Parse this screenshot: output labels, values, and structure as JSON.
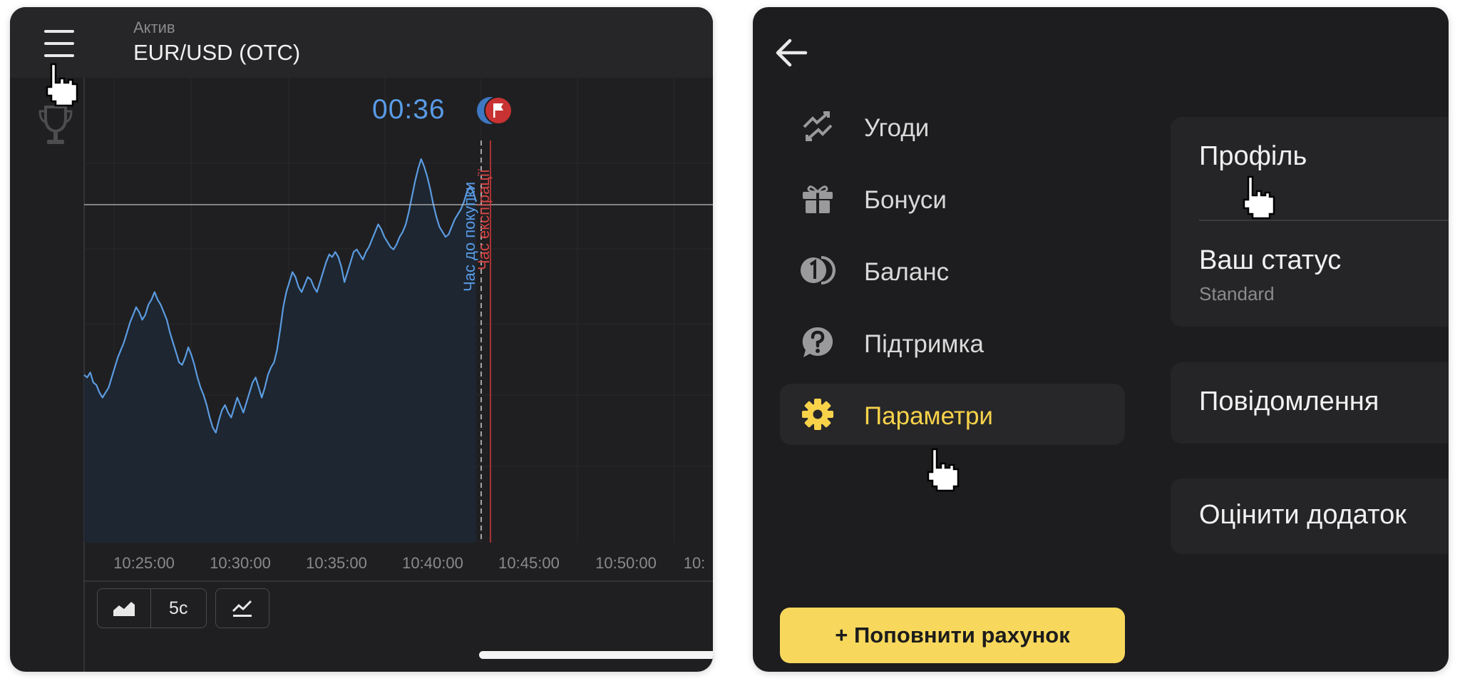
{
  "left_screen": {
    "asset_label": "Актив",
    "asset_name": "EUR/USD (OTC)",
    "countdown": "00:36",
    "purchase_time_label": "Час до покупки",
    "expiration_label": "Час експірації",
    "toolbar": {
      "chart_type_icon": "area-chart-icon",
      "period_label": "5с",
      "indicators_icon": "indicators-icon"
    },
    "colors": {
      "price_line": "#5b9be0",
      "expiration_line": "#d63a3a",
      "timer": "#5a9be6"
    }
  },
  "right_screen": {
    "menu": [
      {
        "label": "Угоди",
        "icon": "trades-icon"
      },
      {
        "label": "Бонуси",
        "icon": "gift-icon"
      },
      {
        "label": "Баланс",
        "icon": "balance-icon"
      },
      {
        "label": "Підтримка",
        "icon": "support-icon"
      },
      {
        "label": "Параметри",
        "icon": "settings-icon",
        "active": true
      }
    ],
    "deposit_button": "+ Поповнити рахунок",
    "settings": {
      "profile": "Профіль",
      "status_title": "Ваш статус",
      "status_value": "Standard",
      "notifications": "Повідомлення",
      "rate_app": "Оцінити додаток"
    },
    "colors": {
      "accent": "#f8d34a",
      "deposit_bg": "#f8d85c"
    }
  },
  "chart_data": {
    "type": "line",
    "x_tick_labels": [
      "10:25:00",
      "10:30:00",
      "10:35:00",
      "10:40:00",
      "10:45:00",
      "10:50:00",
      "10:"
    ],
    "series": [
      {
        "values": [
          0.45,
          0.44,
          0.46,
          0.42,
          0.41,
          0.38,
          0.36,
          0.38,
          0.4,
          0.44,
          0.48,
          0.52,
          0.55,
          0.58,
          0.62,
          0.66,
          0.69,
          0.72,
          0.7,
          0.67,
          0.69,
          0.73,
          0.75,
          0.78,
          0.75,
          0.73,
          0.7,
          0.67,
          0.62,
          0.58,
          0.54,
          0.5,
          0.49,
          0.52,
          0.56,
          0.53,
          0.49,
          0.44,
          0.4,
          0.37,
          0.33,
          0.28,
          0.24,
          0.22,
          0.27,
          0.31,
          0.33,
          0.3,
          0.28,
          0.32,
          0.36,
          0.33,
          0.3,
          0.34,
          0.38,
          0.42,
          0.44,
          0.4,
          0.36,
          0.4,
          0.45,
          0.48,
          0.5,
          0.55,
          0.63,
          0.72,
          0.78,
          0.82,
          0.86,
          0.84,
          0.8,
          0.78,
          0.81,
          0.84,
          0.83,
          0.8,
          0.78,
          0.82,
          0.86,
          0.9,
          0.93,
          0.92,
          0.94,
          0.92,
          0.88,
          0.82,
          0.86,
          0.9,
          0.94,
          0.95,
          0.93,
          0.91,
          0.94,
          0.96,
          0.99,
          1.02,
          1.05,
          1.03,
          1.0,
          0.98,
          0.96,
          0.95,
          0.97,
          1.0,
          1.02,
          1.05,
          1.1,
          1.16,
          1.22,
          1.27,
          1.31,
          1.28,
          1.24,
          1.19,
          1.13,
          1.08,
          1.04,
          1.02,
          1.0,
          1.01,
          1.04,
          1.07,
          1.09,
          1.11,
          1.14,
          1.18,
          1.2,
          1.18,
          1.14
        ]
      }
    ],
    "grid": true
  }
}
